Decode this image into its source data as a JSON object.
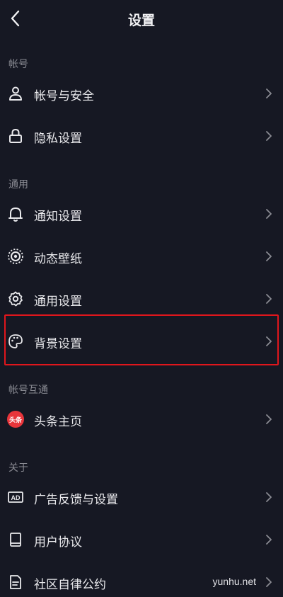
{
  "header": {
    "title": "设置",
    "back_icon": "chevron-left-icon"
  },
  "sections": {
    "account": {
      "label": "帐号",
      "items": [
        {
          "label": "帐号与安全",
          "icon": "user-icon"
        },
        {
          "label": "隐私设置",
          "icon": "lock-icon"
        }
      ]
    },
    "general": {
      "label": "通用",
      "items": [
        {
          "label": "通知设置",
          "icon": "bell-icon"
        },
        {
          "label": "动态壁纸",
          "icon": "wallpaper-icon"
        },
        {
          "label": "通用设置",
          "icon": "gear-icon"
        },
        {
          "label": "背景设置",
          "icon": "palette-icon",
          "highlighted": true
        }
      ]
    },
    "linked": {
      "label": "帐号互通",
      "items": [
        {
          "label": "头条主页",
          "icon": "toutiao-icon",
          "badge_text": "头条"
        }
      ]
    },
    "about": {
      "label": "关于",
      "items": [
        {
          "label": "广告反馈与设置",
          "icon": "ad-icon",
          "icon_text": "AD"
        },
        {
          "label": "用户协议",
          "icon": "book-icon"
        },
        {
          "label": "社区自律公约",
          "icon": "document-icon",
          "value": "yunhu.net"
        }
      ]
    }
  },
  "colors": {
    "background": "#161823",
    "text": "#e9e9ec",
    "section_label": "#8a8b93",
    "highlight_border": "#e0161c",
    "toutiao_badge": "#e8353b"
  }
}
